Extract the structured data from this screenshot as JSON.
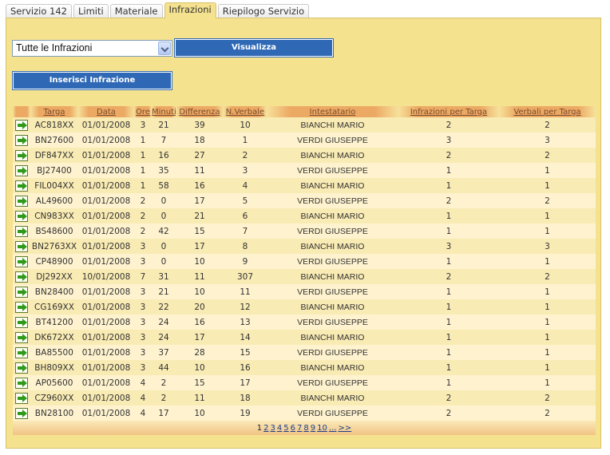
{
  "tabs": [
    {
      "label": "Servizio 142",
      "active": false
    },
    {
      "label": "Limiti",
      "active": false
    },
    {
      "label": "Materiale",
      "active": false
    },
    {
      "label": "Infrazioni",
      "active": true
    },
    {
      "label": "Riepilogo Servizio",
      "active": false
    }
  ],
  "filter": {
    "selected": "Tutte le Infrazioni"
  },
  "buttons": {
    "view": "Visualizza",
    "add": "Inserisci Infrazione"
  },
  "table": {
    "headers": [
      "",
      "Targa",
      "Data",
      "Ore",
      "Minuti",
      "Differenza",
      "N.Verbale",
      "Intestatario",
      "Infrazioni per Targa",
      "Verbali per Targa"
    ],
    "rows": [
      [
        "AC818XX",
        "01/01/2008",
        "3",
        "21",
        "39",
        "10",
        "BIANCHI MARIO",
        "2",
        "2"
      ],
      [
        "BN27600",
        "01/01/2008",
        "1",
        "7",
        "18",
        "1",
        "VERDI GIUSEPPE",
        "3",
        "3"
      ],
      [
        "DF847XX",
        "01/01/2008",
        "1",
        "16",
        "27",
        "2",
        "BIANCHI MARIO",
        "2",
        "2"
      ],
      [
        "BJ27400",
        "01/01/2008",
        "1",
        "35",
        "11",
        "3",
        "VERDI GIUSEPPE",
        "1",
        "1"
      ],
      [
        "FIL004XX",
        "01/01/2008",
        "1",
        "58",
        "16",
        "4",
        "BIANCHI MARIO",
        "1",
        "1"
      ],
      [
        "AL49600",
        "01/01/2008",
        "2",
        "0",
        "17",
        "5",
        "VERDI GIUSEPPE",
        "2",
        "2"
      ],
      [
        "CN983XX",
        "01/01/2008",
        "2",
        "0",
        "21",
        "6",
        "BIANCHI MARIO",
        "1",
        "1"
      ],
      [
        "BS48600",
        "01/01/2008",
        "2",
        "42",
        "15",
        "7",
        "VERDI GIUSEPPE",
        "1",
        "1"
      ],
      [
        "BN2763XX",
        "01/01/2008",
        "3",
        "0",
        "17",
        "8",
        "BIANCHI MARIO",
        "3",
        "3"
      ],
      [
        "CP48900",
        "01/01/2008",
        "3",
        "0",
        "10",
        "9",
        "VERDI GIUSEPPE",
        "1",
        "1"
      ],
      [
        "DJ292XX",
        "10/01/2008",
        "7",
        "31",
        "11",
        "307",
        "BIANCHI MARIO",
        "2",
        "2"
      ],
      [
        "BN28400",
        "01/01/2008",
        "3",
        "21",
        "10",
        "11",
        "VERDI GIUSEPPE",
        "1",
        "1"
      ],
      [
        "CG169XX",
        "01/01/2008",
        "3",
        "22",
        "20",
        "12",
        "BIANCHI MARIO",
        "1",
        "1"
      ],
      [
        "BT41200",
        "01/01/2008",
        "3",
        "24",
        "16",
        "13",
        "VERDI GIUSEPPE",
        "1",
        "1"
      ],
      [
        "DK672XX",
        "01/01/2008",
        "3",
        "24",
        "17",
        "14",
        "BIANCHI MARIO",
        "1",
        "1"
      ],
      [
        "BA85500",
        "01/01/2008",
        "3",
        "37",
        "28",
        "15",
        "VERDI GIUSEPPE",
        "1",
        "1"
      ],
      [
        "BH809XX",
        "01/01/2008",
        "3",
        "44",
        "10",
        "16",
        "BIANCHI MARIO",
        "1",
        "1"
      ],
      [
        "AP05600",
        "01/01/2008",
        "4",
        "2",
        "15",
        "17",
        "VERDI GIUSEPPE",
        "1",
        "1"
      ],
      [
        "CZ960XX",
        "01/01/2008",
        "4",
        "2",
        "11",
        "18",
        "BIANCHI MARIO",
        "2",
        "2"
      ],
      [
        "BN28100",
        "01/01/2008",
        "4",
        "17",
        "10",
        "19",
        "VERDI GIUSEPPE",
        "2",
        "2"
      ]
    ],
    "row_icon": "green-arrow-icon"
  },
  "pagination": {
    "current": "1",
    "pages": [
      "2",
      "3",
      "4",
      "5",
      "6",
      "7",
      "8",
      "9",
      "10",
      "...",
      ">>"
    ]
  }
}
